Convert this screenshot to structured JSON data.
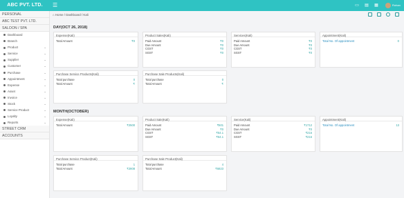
{
  "brand": "ABC PVT. LTD.",
  "user": "Rohan",
  "sidebar": {
    "sections": [
      "PERSONAL",
      "ABC TEST PVT. LTD.",
      "SALOON / SPA"
    ],
    "items": [
      {
        "label": "Dashboard",
        "chev": false
      },
      {
        "label": "Branch",
        "chev": false
      },
      {
        "label": "Product",
        "chev": true
      },
      {
        "label": "Service",
        "chev": true
      },
      {
        "label": "Supplier",
        "chev": true
      },
      {
        "label": "Customer",
        "chev": true
      },
      {
        "label": "Purchase",
        "chev": true
      },
      {
        "label": "Appointment",
        "chev": true
      },
      {
        "label": "Expense",
        "chev": true
      },
      {
        "label": "Asset",
        "chev": true
      },
      {
        "label": "Invoice",
        "chev": true
      },
      {
        "label": "Stock",
        "chev": true
      },
      {
        "label": "Service Product",
        "chev": true
      },
      {
        "label": "Loyalty",
        "chev": true
      },
      {
        "label": "Reports",
        "chev": true
      }
    ],
    "bottom": [
      "STREET CRM",
      "ACCOUNTS"
    ]
  },
  "breadcrumb": "Home / Dashboard / Kali",
  "day": {
    "title": "DAY(OCT 26, 2018)",
    "expense": {
      "title": "Expense(Kali)",
      "rows": [
        {
          "label": "Total Amount",
          "value": "₹0"
        }
      ]
    },
    "product_sales": {
      "title": "Product Sales(Kali)",
      "rows": [
        {
          "label": "Paid Amount",
          "value": "₹0"
        },
        {
          "label": "Due Amount",
          "value": "₹0"
        },
        {
          "label": "CGST",
          "value": "₹0"
        },
        {
          "label": "SGST",
          "value": "₹0"
        }
      ]
    },
    "services": {
      "title": "Services(Kali)",
      "rows": [
        {
          "label": "Paid Amount",
          "value": "₹0"
        },
        {
          "label": "Due Amount",
          "value": "₹0"
        },
        {
          "label": "CGST",
          "value": "₹0"
        },
        {
          "label": "SGST",
          "value": "₹0"
        }
      ]
    },
    "appointment": {
      "title": "Appointment(Kali)",
      "link": "Total No. Of appointment",
      "value": "0"
    },
    "purchase_service": {
      "title": "Purchase Service Products(Kali)",
      "rows": [
        {
          "label": "Total purchase",
          "value": "0"
        },
        {
          "label": "Total Amount",
          "value": "₹"
        }
      ]
    },
    "purchase_sale": {
      "title": "Purchase Sale Products(Kali)",
      "rows": [
        {
          "label": "Total purchase",
          "value": "0"
        },
        {
          "label": "Total Amount",
          "value": "₹"
        }
      ]
    }
  },
  "month": {
    "title": "MONTH(OCTOBER)",
    "expense": {
      "title": "Expense(Kali)",
      "rows": [
        {
          "label": "Total Amount",
          "value": "₹2500"
        }
      ]
    },
    "product_sale": {
      "title": "Product Sale(Kali)",
      "rows": [
        {
          "label": "Paid Amount",
          "value": "₹501"
        },
        {
          "label": "Due Amount",
          "value": "₹0"
        },
        {
          "label": "CGST",
          "value": "₹54.1"
        },
        {
          "label": "SGST",
          "value": "₹54.1"
        }
      ]
    },
    "service": {
      "title": "Service(Kali)",
      "rows": [
        {
          "label": "Paid Amount",
          "value": "₹1712"
        },
        {
          "label": "Due Amount",
          "value": "₹0"
        },
        {
          "label": "CGST",
          "value": "₹216"
        },
        {
          "label": "SGST",
          "value": "₹216"
        }
      ]
    },
    "appointment": {
      "title": "Appointment(Kali)",
      "link": "Total No. Of appointment",
      "value": "13"
    },
    "purchase_service": {
      "title": "Purchase Service Product(Kali)",
      "rows": [
        {
          "label": "Total purchase",
          "value": "1"
        },
        {
          "label": "Total Amount",
          "value": "₹2808"
        }
      ]
    },
    "purchase_sale": {
      "title": "Purchase Sale Product(Kali)",
      "rows": [
        {
          "label": "Total purchase",
          "value": "4"
        },
        {
          "label": "Total Amount",
          "value": "₹6823"
        }
      ]
    }
  }
}
